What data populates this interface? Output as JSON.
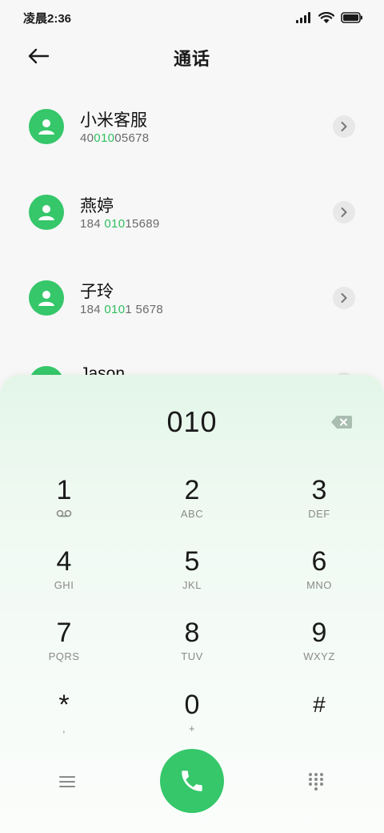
{
  "status_bar": {
    "time": "凌晨2:36",
    "icons": [
      "signal-icon",
      "wifi-icon",
      "battery-icon"
    ]
  },
  "header": {
    "title": "通话",
    "back_icon": "arrow-left-icon"
  },
  "contacts": [
    {
      "name": "小米客服",
      "number_pre": "40",
      "number_match": "010",
      "number_post": "05678"
    },
    {
      "name": "燕婷",
      "number_pre": "184 ",
      "number_match": "010",
      "number_post": "15689"
    },
    {
      "name": "子玲",
      "number_pre": "184 ",
      "number_match": "010",
      "number_post": "1 5678"
    },
    {
      "name": "Jason",
      "number_pre": "",
      "number_match": "",
      "number_post": ""
    }
  ],
  "dialpad": {
    "input": "010",
    "keys": [
      {
        "digit": "1",
        "sub": "voicemail-icon"
      },
      {
        "digit": "2",
        "sub": "ABC"
      },
      {
        "digit": "3",
        "sub": "DEF"
      },
      {
        "digit": "4",
        "sub": "GHI"
      },
      {
        "digit": "5",
        "sub": "JKL"
      },
      {
        "digit": "6",
        "sub": "MNO"
      },
      {
        "digit": "7",
        "sub": "PQRS"
      },
      {
        "digit": "8",
        "sub": "TUV"
      },
      {
        "digit": "9",
        "sub": "WXYZ"
      },
      {
        "digit": "*",
        "sub": ","
      },
      {
        "digit": "0",
        "sub": "+"
      },
      {
        "digit": "#",
        "sub": ""
      }
    ]
  },
  "colors": {
    "accent": "#35c76a",
    "highlight": "#2fbf5f"
  }
}
